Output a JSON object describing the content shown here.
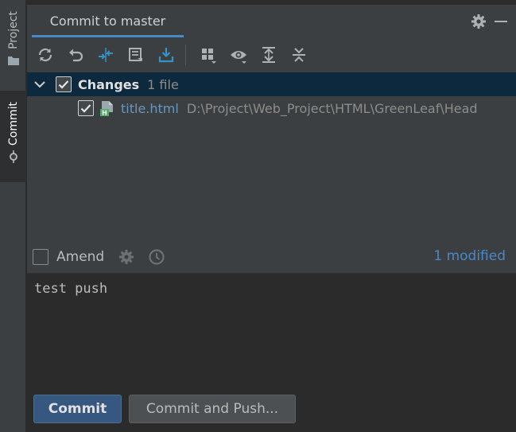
{
  "side": {
    "project_label": "Project",
    "commit_label": "Commit"
  },
  "header": {
    "tab_label": "Commit to master",
    "settings_icon": "gear-icon",
    "minimize_icon": "minimize-icon"
  },
  "toolbar": {
    "items": [
      "refresh-icon",
      "rollback-icon",
      "diff-icon",
      "shelve-icon",
      "update-icon",
      "group-by-icon",
      "view-options-icon",
      "expand-all-icon",
      "collapse-all-icon"
    ]
  },
  "changes": {
    "group_label": "Changes",
    "group_count": "1 file",
    "file_name": "title.html",
    "file_path": "D:\\Project\\Web_Project\\HTML\\GreenLeaf\\Head"
  },
  "amend": {
    "label": "Amend",
    "modified": "1 modified"
  },
  "message": {
    "text": "test push"
  },
  "buttons": {
    "commit": "Commit",
    "commit_and_push": "Commit and Push..."
  },
  "colors": {
    "accent": "#4a88c7",
    "selection": "#0d293e",
    "panel": "#3c3f41",
    "editor": "#2b2b2b",
    "primary_button": "#365880"
  }
}
